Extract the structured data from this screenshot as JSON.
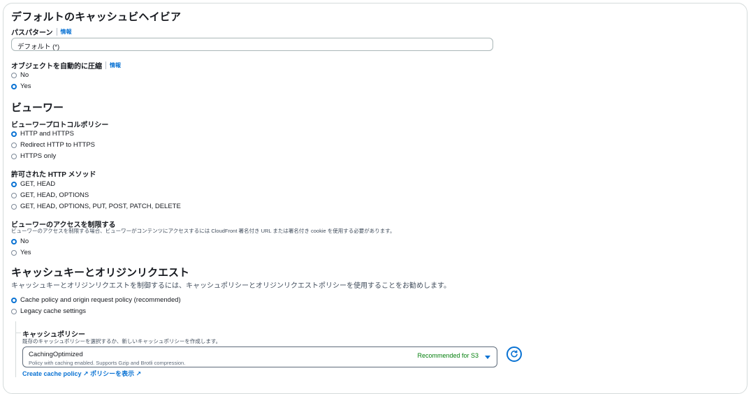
{
  "section_default": {
    "title": "デフォルトのキャッシュビヘイビア",
    "path_pattern": {
      "label": "パスパターン",
      "info": "情報",
      "value": "デフォルト (*)"
    },
    "compress": {
      "label": "オブジェクトを自動的に圧縮",
      "info": "情報",
      "options": [
        "No",
        "Yes"
      ],
      "selected": "Yes"
    }
  },
  "section_viewer": {
    "title": "ビューワー",
    "protocol": {
      "label": "ビューワープロトコルポリシー",
      "options": [
        "HTTP and HTTPS",
        "Redirect HTTP to HTTPS",
        "HTTPS only"
      ],
      "selected": "HTTP and HTTPS"
    },
    "methods": {
      "label": "許可された HTTP メソッド",
      "options": [
        "GET, HEAD",
        "GET, HEAD, OPTIONS",
        "GET, HEAD, OPTIONS, PUT, POST, PATCH, DELETE"
      ],
      "selected": "GET, HEAD"
    },
    "restrict": {
      "label": "ビューワーのアクセスを制限する",
      "description": "ビューワーのアクセスを制限する場合、ビューワーがコンテンツにアクセスするには CloudFront 署名付き URL または署名付き cookie を使用する必要があります。",
      "options": [
        "No",
        "Yes"
      ],
      "selected": "No"
    }
  },
  "section_cache": {
    "title": "キャッシュキーとオリジンリクエスト",
    "description": "キャッシュキーとオリジンリクエストを制御するには、キャッシュポリシーとオリジンリクエストポリシーを使用することをお勧めします。",
    "options": [
      "Cache policy and origin request policy (recommended)",
      "Legacy cache settings"
    ],
    "selected": "Cache policy and origin request policy (recommended)",
    "cache_policy": {
      "label": "キャッシュポリシー",
      "description": "既存のキャッシュポリシーを選択するか、新しいキャッシュポリシーを作成します。",
      "selected_title": "CachingOptimized",
      "selected_sub": "Policy with caching enabled. Supports Gzip and Brotli compression.",
      "tag": "Recommended for S3",
      "links": "Create cache policy  ↗   ポリシーを表示 ↗"
    }
  }
}
